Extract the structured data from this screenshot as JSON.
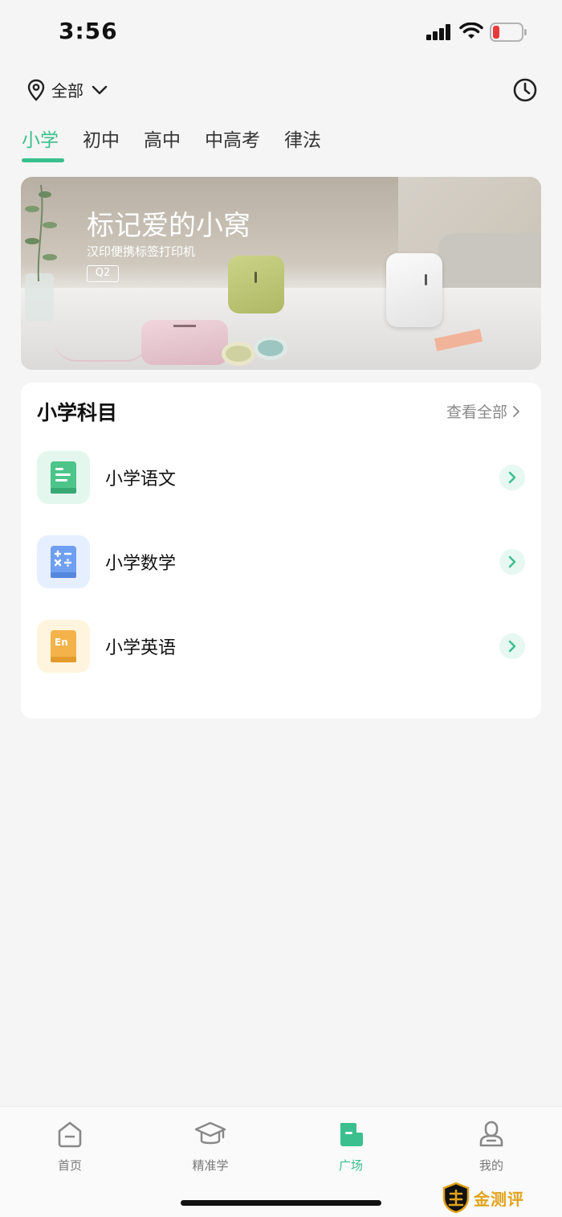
{
  "status_bar": {
    "time": "3:56"
  },
  "header": {
    "location_label": "全部"
  },
  "tabs": [
    {
      "label": "小学",
      "active": true
    },
    {
      "label": "初中",
      "active": false
    },
    {
      "label": "高中",
      "active": false
    },
    {
      "label": "中高考",
      "active": false
    },
    {
      "label": "律法",
      "active": false
    }
  ],
  "banner": {
    "title": "标记爱的小窝",
    "subtitle": "汉印便携标签打印机",
    "badge": "Q2"
  },
  "subjects_section": {
    "title": "小学科目",
    "view_all": "查看全部",
    "items": [
      {
        "label": "小学语文",
        "icon": "book-icon",
        "color": "#4cc48a",
        "bg": "#e3f7ee"
      },
      {
        "label": "小学数学",
        "icon": "math-icon",
        "color": "#6f9ff0",
        "bg": "#e6efff"
      },
      {
        "label": "小学英语",
        "icon": "english-icon",
        "color": "#f3b34a",
        "bg": "#fff4dd",
        "icon_text": "En"
      }
    ]
  },
  "bottom_nav": [
    {
      "label": "首页",
      "icon": "home-icon",
      "active": false
    },
    {
      "label": "精准学",
      "icon": "graduation-cap-icon",
      "active": false
    },
    {
      "label": "广场",
      "icon": "square-icon",
      "active": true
    },
    {
      "label": "我的",
      "icon": "profile-icon",
      "active": false
    }
  ],
  "watermark": {
    "text": "金测评"
  },
  "colors": {
    "accent": "#3bbf8e",
    "background": "#f5f5f5"
  }
}
